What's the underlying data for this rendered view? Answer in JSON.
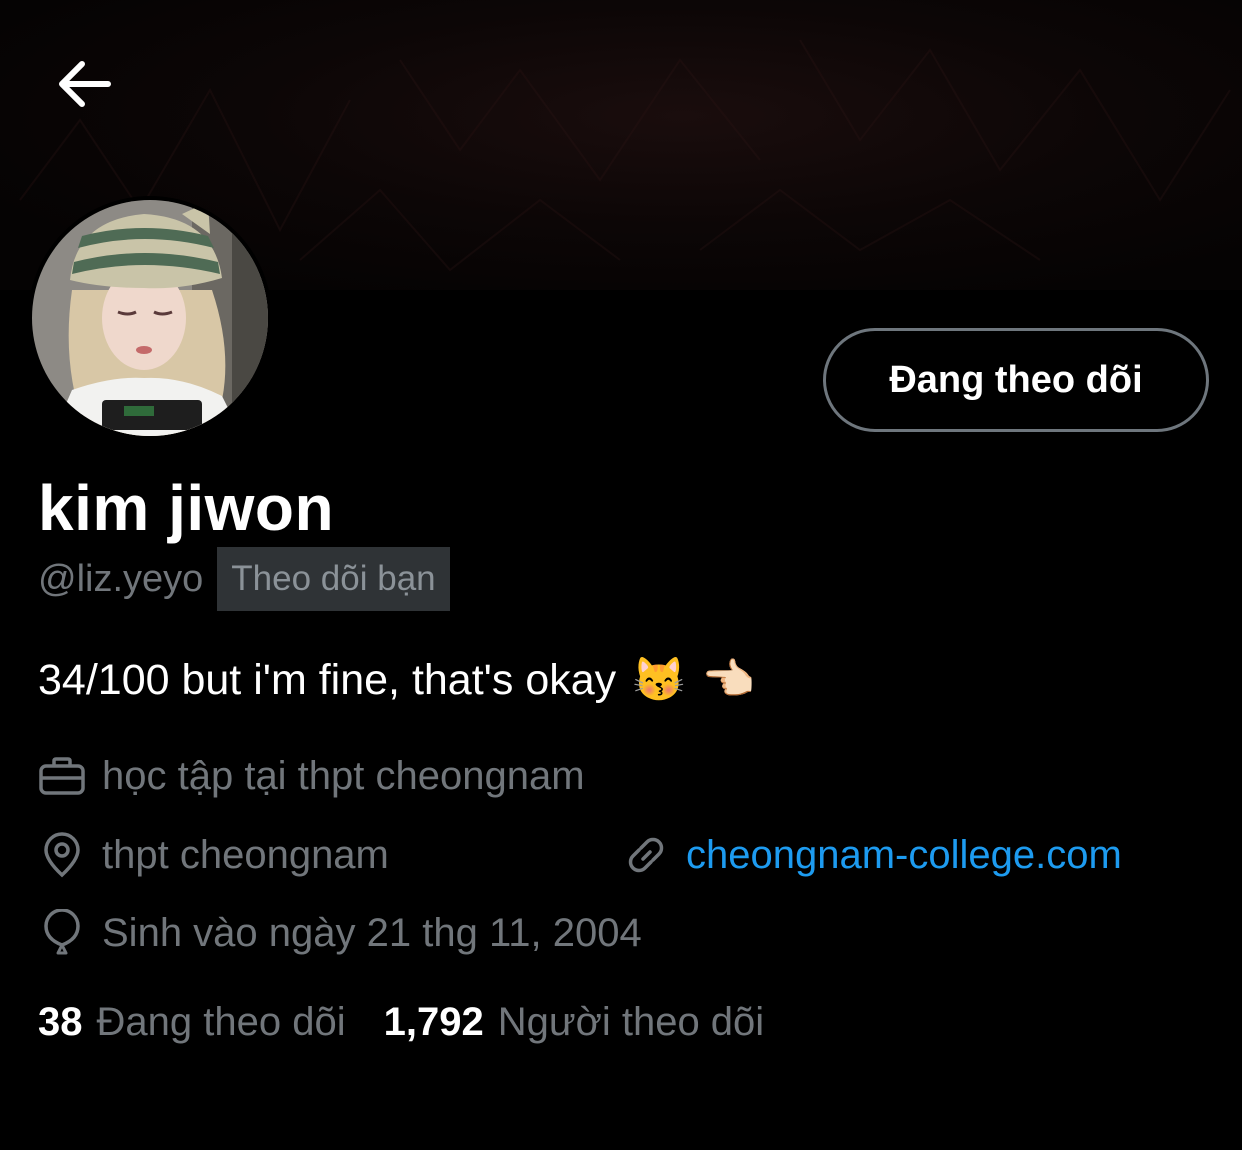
{
  "header": {
    "back_icon": "arrow-left-icon"
  },
  "profile": {
    "avatar_icon": "avatar-photo",
    "follow_button_label": "Đang theo dõi",
    "display_name": "kim jiwon",
    "handle": "@liz.yeyo",
    "follows_you_badge": "Theo dõi bạn",
    "bio": "34/100 but i'm fine, that's okay",
    "bio_emojis": [
      "😽",
      "👈🏻"
    ],
    "work": "học tập tại thpt cheongnam",
    "location": "thpt cheongnam",
    "website": "cheongnam-college.com",
    "birthday": "Sinh vào ngày 21 thg 11, 2004"
  },
  "stats": {
    "following_count": "38",
    "following_label": "Đang theo dõi",
    "followers_count": "1,792",
    "followers_label": "Người theo dõi"
  },
  "colors": {
    "background": "#000000",
    "primary_text": "#ffffff",
    "secondary_text": "#71767b",
    "link": "#1d9bf0",
    "button_border": "#6e767d",
    "badge_bg": "#2f3336"
  }
}
